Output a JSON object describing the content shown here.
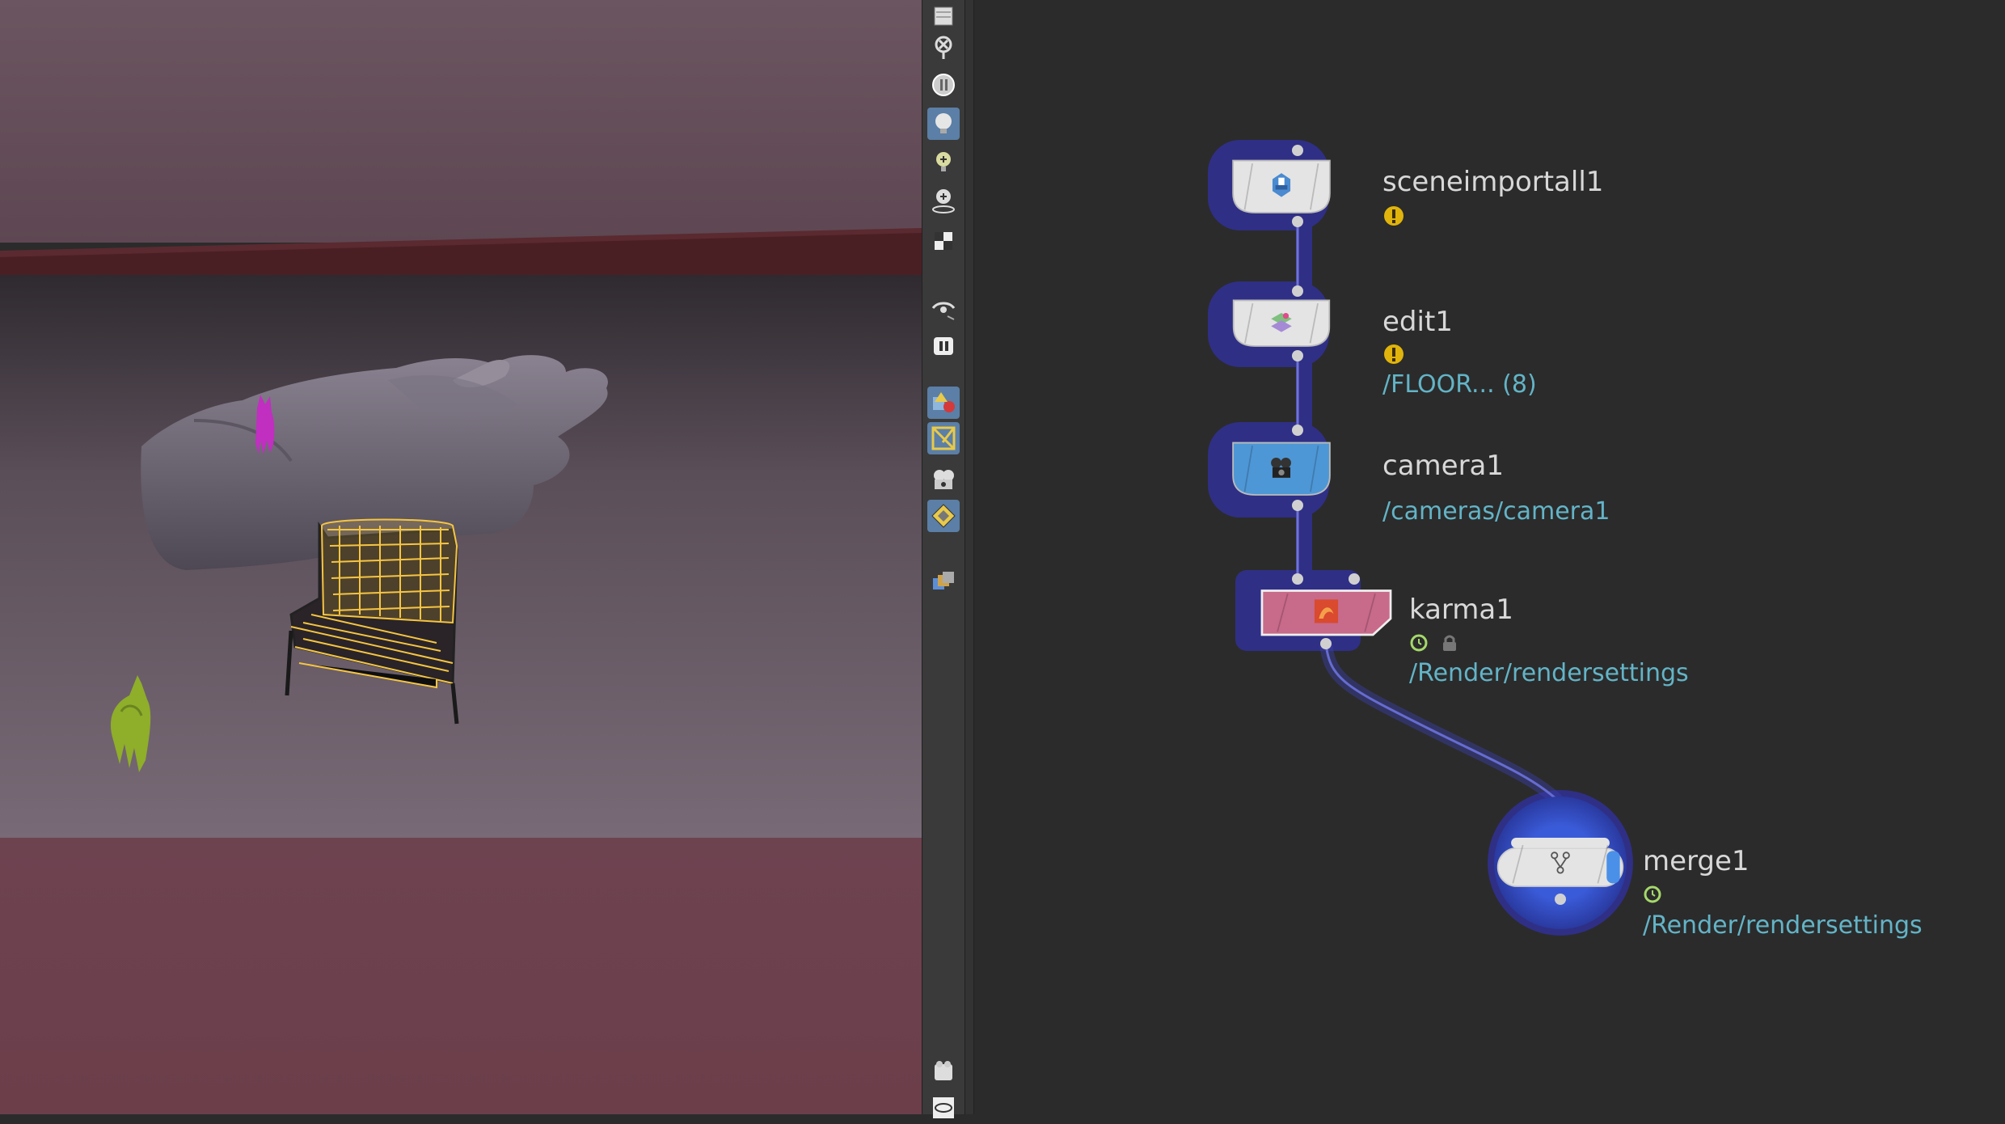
{
  "viewport": {
    "colors": {
      "sky": "#6b5560",
      "back_wall": "#4a1f24",
      "floor": "#6e5f6c",
      "foreground": "#6b3f4b",
      "selection": "#f5c542",
      "cat_magenta": "#c02fc0",
      "cat_green": "#8fae2a"
    }
  },
  "shelf": {
    "tools": [
      {
        "name": "display-options-icon",
        "active": false
      },
      {
        "name": "lop-close-icon",
        "active": false
      },
      {
        "name": "headlight-icon",
        "active": false
      },
      {
        "name": "light-bulb-icon",
        "active": true
      },
      {
        "name": "add-light-icon",
        "active": false
      },
      {
        "name": "light-placer-icon",
        "active": false
      },
      {
        "name": "render-cube-icon",
        "active": false
      },
      {
        "name": "view-eye-icon",
        "active": false
      },
      {
        "name": "pause-render-icon",
        "active": false
      },
      {
        "name": "shapes-icon",
        "active": true
      },
      {
        "name": "select-transform-icon",
        "active": true
      },
      {
        "name": "camera-reel-icon",
        "active": false
      },
      {
        "name": "snap-diamond-icon",
        "active": true
      },
      {
        "name": "layers-icon",
        "active": false
      },
      {
        "name": "flipbook-icon",
        "active": false
      },
      {
        "name": "eye-small-icon",
        "active": false
      }
    ]
  },
  "network": {
    "nodes": [
      {
        "id": "sceneimportall1",
        "label": "sceneimportall1",
        "icon": "scene-import-icon",
        "flags": [
          "warning"
        ],
        "path": ""
      },
      {
        "id": "edit1",
        "label": "edit1",
        "icon": "edit-prims-icon",
        "flags": [
          "warning"
        ],
        "path": "/FLOOR... (8)"
      },
      {
        "id": "camera1",
        "label": "camera1",
        "icon": "camera-icon",
        "flags": [],
        "path": "/cameras/camera1"
      },
      {
        "id": "karma1",
        "label": "karma1",
        "icon": "karma-render-icon",
        "flags": [
          "timedep",
          "lock"
        ],
        "path": "/Render/rendersettings"
      },
      {
        "id": "merge1",
        "label": "merge1",
        "icon": "merge-icon",
        "flags": [
          "timedep"
        ],
        "path": "/Render/rendersettings"
      }
    ],
    "colors": {
      "highlight": "#2f2f86",
      "wire": "#6f74d6",
      "warning": "#e0b40c",
      "timedep": "#a5d86b",
      "path_text": "#63b4c7",
      "camera_node": "#4e97d6",
      "karma_node": "#c86a8a"
    }
  }
}
